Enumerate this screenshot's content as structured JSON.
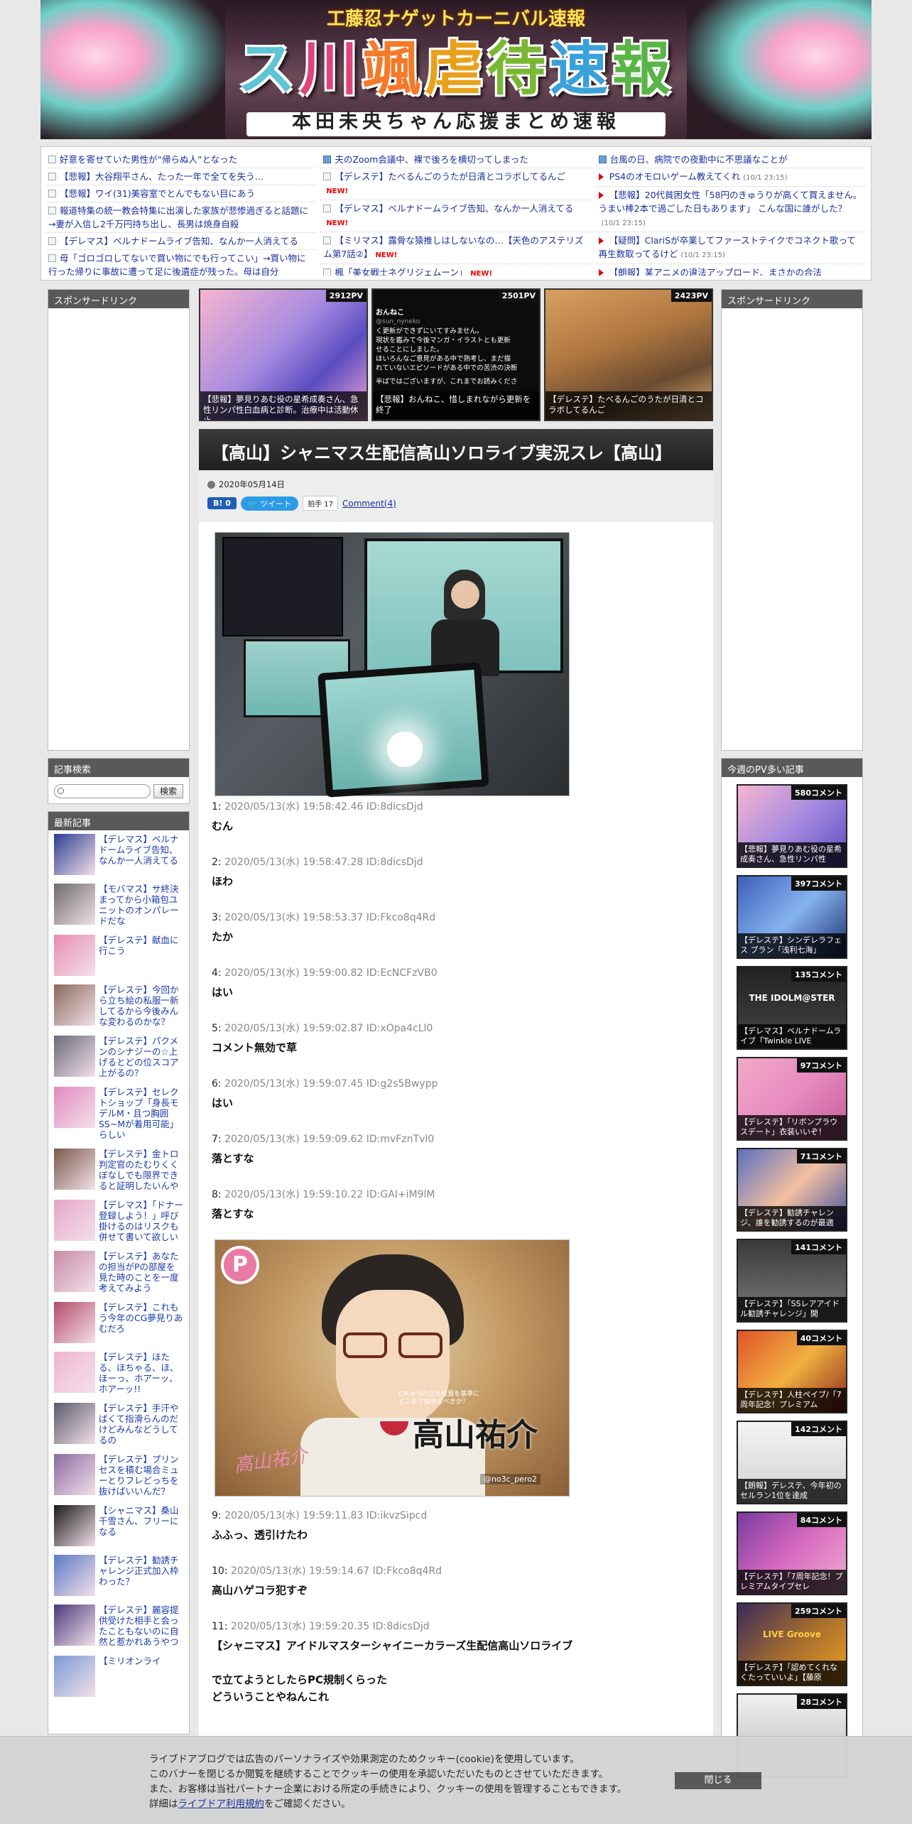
{
  "header": {
    "subtitle": "工藤忍ナゲットカーニバル速報",
    "title_chars": [
      "ス",
      "川",
      "颯",
      "虐",
      "待",
      "速",
      "報"
    ],
    "tagline": "本田未央ちゃん応援まとめ速報"
  },
  "ticker": {
    "col1": [
      {
        "text": "好意を寄せていた男性が“帰らぬ人”となった",
        "icon": "doc"
      },
      {
        "text": "【悲報】大谷翔平さん、たった一年で全てを失う…",
        "icon": "doc"
      },
      {
        "text": "【悲報】ワイ(31)美容室でとんでもない目にあう",
        "icon": "doc"
      },
      {
        "text": "報道特集の統一教会特集に出演した家族が悲惨過ぎると話題に→妻が入信し2千万円持ち出し、長男は焼身自殺",
        "icon": "doc"
      },
      {
        "text": "【デレマス】ベルナドームライブ告知、なんか一人消えてる",
        "icon": "doc"
      },
      {
        "text": "母「ゴロゴロしてないで買い物にでも行ってこい」→買い物に行った帰りに事故に遭って足に後遺症が残った。母は自分",
        "icon": "doc"
      }
    ],
    "col2": [
      {
        "text": "夫のZoom会議中、裸で後ろを横切ってしまった",
        "icon": "chk",
        "new": false
      },
      {
        "text": "【デレステ】たべるんごのうたが日清とコラボしてるんご",
        "icon": "doc",
        "new": true
      },
      {
        "text": "【デレマス】ベルナドームライブ告知、なんか一人消えてる",
        "icon": "doc",
        "new": true
      },
      {
        "text": "【ミリマス】露骨な猿推しはしないなの…【天色のアステリズム第7話②】",
        "icon": "doc",
        "new": true
      },
      {
        "text": "楓「美女戦士ネグリジェムーン」",
        "icon": "doc",
        "new": true
      }
    ],
    "col3": [
      {
        "text": "台風の日、病院での夜勤中に不思議なことが",
        "icon": "chk",
        "date": ""
      },
      {
        "text": "PS4のオモロいゲーム教えてくれ",
        "icon": "arr",
        "date": "(10/1 23:15)"
      },
      {
        "text": "【悲報】20代貧困女性「58円のきゅうりが高くて買えません。うまい棒2本で過ごした日もあります」 こんな国に誰がした？",
        "icon": "arr",
        "date": "(10/1 23:15)"
      },
      {
        "text": "【疑問】ClariSが卒業してファーストテイクでコネクト歌って再生数取ってるけど",
        "icon": "arr",
        "date": "(10/1 23:15)"
      },
      {
        "text": "【朗報】某アニメの違法アップロード、まさかの合法",
        "icon": "arr",
        "date": ""
      }
    ],
    "new_label": "NEW!"
  },
  "sidebar_left": {
    "sponsor_title": "スポンサードリンク",
    "search_title": "記事検索",
    "search_button": "検索",
    "search_placeholder": "",
    "recent_title": "最新記事",
    "recent": [
      "【デレマス】ベルナドームライブ告知、なんか一人消えてる",
      "【モバマス】サ終決まってから小箱包ユニットのオンパレードだな",
      "【デレステ】献血に行こう",
      "【デレステ】今回から立ち絵の私服一新してるから今後みんな変わるのかな？",
      "【デレステ】パクメンのシナジーの☆上げるとどの位スコア上がるの？",
      "【デレステ】セレクトショップ「身長モデルM・且つ胸囲SS~Mが着用可能」らしい",
      "【デレステ】金トロ判定官のたむりくくぼなしでも限界できると証明したいんや",
      "【デレマス】「ドナー登録しよう！」呼び掛けるのはリスクも併せて書いて欲しい",
      "【デレステ】あなたの担当がPの部屋を見た時のことを一度考えてみよう",
      "【デレステ】これもう今年のCG夢見りあむだろ",
      "【デレステ】ほたる、ほちゃる、ほ、ほーっ、ホアーッ、ホアーッ!!",
      "【デレステ】手汗やばくて指滑らんのだけどみんなどうしてるの",
      "【デレステ】プリンセスを積む場合ミューとりフレどっちを抜けばいいんだ？",
      "【シャニマス】桑山千雪さん、フリーになる",
      "【デレステ】勧誘チャレンジ正式加入枠わった？",
      "【デレステ】麗容提供受けた相手と会ったこともないのに自然と惹かれあうやつ",
      "【ミリオンライ"
    ]
  },
  "thumbs": [
    {
      "pv": "2912PV",
      "caption": "【悲報】夢見りあむ役の星希成奏さん、急性リンパ性白血病と診断。治療中は活動休止"
    },
    {
      "pv": "2501PV",
      "caption": "【悲報】おんねこ、惜しまれながら更新を終了"
    },
    {
      "pv": "2423PV",
      "caption": "【デレステ】たべるんごのうたが日清とコラボしてるんご"
    }
  ],
  "thumb2_text": [
    "おんねこ",
    "@sun_nyneko",
    "く更新ができずにいてすみません。",
    "現状を鑑みて今後マンガ・イラストとも更新",
    "せることにしました。",
    "ほいろんなご意見がある中で熱考し、まだ描",
    "れていないエピソードがある中での苦渋の決断",
    "",
    "半ばではございますが、これまでお読みくださ"
  ],
  "article": {
    "title": "【高山】シャニマス生配信高山ソロライブ実況スレ【高山】",
    "date": "2020年05月14日",
    "hatena": "B! 0",
    "tweet": "ツイート",
    "clap": "拍手 17",
    "comment": "Comment(4)",
    "pic2_text": "高山祐介",
    "pic2_small": "Cキャラの立ち位置を基準に\nどこまで似せるべきか？",
    "pic2_sig": "高山祐介",
    "pic2_handle": "@no3c_pero2",
    "responses": [
      {
        "n": "1:",
        "h": "2020/05/13(水) 19:58:42.46 ID:8dicsDjd",
        "b": "むん"
      },
      {
        "n": "2:",
        "h": "2020/05/13(水) 19:58:47.28 ID:8dicsDjd",
        "b": "ほわ"
      },
      {
        "n": "3:",
        "h": "2020/05/13(水) 19:58:53.37 ID:Fkco8q4Rd",
        "b": "たか"
      },
      {
        "n": "4:",
        "h": "2020/05/13(水) 19:59:00.82 ID:EcNCFzVB0",
        "b": "はい"
      },
      {
        "n": "5:",
        "h": "2020/05/13(水) 19:59:02.87 ID:xOpa4cLl0",
        "b": "コメント無効で草"
      },
      {
        "n": "6:",
        "h": "2020/05/13(水) 19:59:07.45 ID:g2s5Bwypp",
        "b": "はい"
      },
      {
        "n": "7:",
        "h": "2020/05/13(水) 19:59:09.62 ID:mvFznTvl0",
        "b": "落とすな"
      },
      {
        "n": "8:",
        "h": "2020/05/13(水) 19:59:10.22 ID:GAI+iM9lM",
        "b": "落とすな"
      },
      {
        "n": "9:",
        "h": "2020/05/13(水) 19:59:11.83 ID:ikvzSipcd",
        "b": "ふふっ、透引けたわ"
      },
      {
        "n": "10:",
        "h": "2020/05/13(水) 19:59:14.67 ID:Fkco8q4Rd",
        "b": "高山ハゲコラ犯すぞ"
      },
      {
        "n": "11:",
        "h": "2020/05/13(水) 19:59:20.35 ID:8dicsDjd",
        "b": "【シャニマス】アイドルマスターシャイニーカラーズ生配信高山ソロライブ\n\nで立てようとしたらPC規制くらった\nどういうことやねんこれ"
      }
    ]
  },
  "sidebar_right": {
    "sponsor_title": "スポンサードリンク",
    "pv_title": "今週のPV多い記事",
    "items": [
      {
        "cnt": "580コメント",
        "cap": "【悲報】夢見りあむ役の星希成奏さん、急性リンパ性"
      },
      {
        "cnt": "397コメント",
        "cap": "【デレステ】シンデレラフェス ブラン「浅利七海」"
      },
      {
        "cnt": "135コメント",
        "cap": "【デレマス】ベルナドームライブ「Twinkle LIVE"
      },
      {
        "cnt": "97コメント",
        "cap": "【デレステ】「リボンプラウスデート」衣装いいぞ！"
      },
      {
        "cnt": "71コメント",
        "cap": "【デレステ】勧誘チャレンジ、誰を勧誘するのが最適"
      },
      {
        "cnt": "141コメント",
        "cap": "【デレステ】「SSレアアイドル勧誘チャレンジ」開"
      },
      {
        "cnt": "40コメント",
        "cap": "【デレステ】人柱ペイブ/「7周年記念！プレミアム"
      },
      {
        "cnt": "142コメント",
        "cap": "【朗報】デレステ、今年初のセルラン1位を達成"
      },
      {
        "cnt": "84コメント",
        "cap": "【デレステ】「7周年記念！プレミアムタイプセレ"
      },
      {
        "cnt": "259コメント",
        "cap": "【デレステ】「認めてくれなくたっていいよ」【藤原"
      },
      {
        "cnt": "28コメント",
        "cap": ""
      }
    ],
    "pv_item3_logo": "THE IDOLM@STER",
    "pv_item10_logo": "LIVE Groove"
  },
  "cookie": {
    "line1": "ライブドアブログでは広告のパーソナライズや効果測定のためクッキー(cookie)を使用しています。",
    "line2": "このバナーを閉じるか閲覧を継続することでクッキーの使用を承認いただいたものとさせていただきます。",
    "line3": "また、お客様は当社パートナー企業における所定の手続きにより、クッキーの使用を管理することもできます。",
    "line4_pre": "詳細は",
    "line4_link": "ライブドア利用規約",
    "line4_post": "をご確認ください。",
    "close": "閉じる"
  }
}
